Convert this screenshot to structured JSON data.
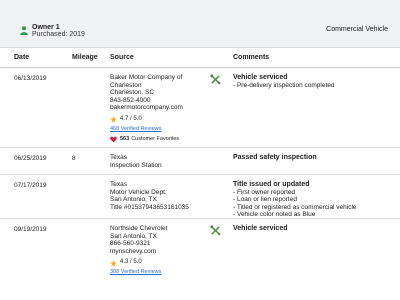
{
  "owner": {
    "title": "Owner 1",
    "purchased": "Purchased: 2019",
    "vehicle_type": "Commercial Vehicle",
    "icon": "person-icon"
  },
  "columns": {
    "date": "Date",
    "mileage": "Mileage",
    "source": "Source",
    "comments": "Comments"
  },
  "records": [
    {
      "date": "06/13/2019",
      "mileage": "",
      "source": [
        "Baker Motor Company of",
        "Charleston",
        "Charleston, SC",
        "843-852-4000",
        "bakermotorcompany.com"
      ],
      "rating": "4.7 / 5.0",
      "reviews": "468 Verified Reviews",
      "favorites_count": "563",
      "favorites_label": "Customer Favorites",
      "icon": "wrench-icon",
      "comment_title": "Vehicle serviced",
      "comment_lines": [
        "- Pre-delivery inspection completed"
      ]
    },
    {
      "date": "06/25/2019",
      "mileage": "8",
      "source": [
        "Texas",
        "Inspection Station"
      ],
      "comment_title": "Passed safety inspection",
      "comment_lines": []
    },
    {
      "date": "07/17/2019",
      "mileage": "",
      "source": [
        "Texas",
        "Motor Vehicle Dept.",
        "San Antonio, TX",
        "Title #01537943653161035"
      ],
      "comment_title": "Title issued or updated",
      "comment_lines": [
        "- First owner reported",
        "- Loan or lien reported",
        "- Titled or registered as commercial vehicle",
        "- Vehicle color noted as Blue"
      ]
    },
    {
      "date": "09/19/2019",
      "mileage": "",
      "source": [
        "Northside Chevrolet",
        "San Antonio, TX",
        "866-560-9321",
        "mynschevy.com"
      ],
      "rating": "4.3 / 5.0",
      "reviews": "308 Verified Reviews",
      "icon": "wrench-icon",
      "comment_title": "Vehicle serviced",
      "comment_lines": []
    }
  ],
  "colors": {
    "header_bg": "#f0f1f2",
    "owner_icon": "#2e9e4f",
    "star": "#f2b01e",
    "heart": "#c8214a",
    "link": "#2a6fd6",
    "wrench": "#4a8a3c"
  }
}
